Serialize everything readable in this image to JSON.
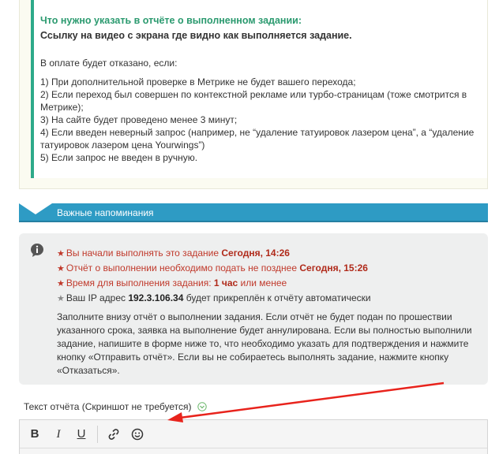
{
  "report_requirements": {
    "title": "Что нужно указать в отчёте о выполненном задании:",
    "subtitle": "Ссылку на видео с экрана где видно как выполняется задание.",
    "refusal_intro": "В оплате будет отказано, если:",
    "refusal_items": [
      "1) При дополнительной проверке в Метрике не будет вашего перехода;",
      "2) Если переход был совершен по контекстной рекламе или турбо-страницам (тоже смотрится в Метрике);",
      "3) На сайте будет проведено менее 3 минут;",
      "4) Если введен неверный запрос (например, не “удаление татуировок лазером цена”, а “удаление татуировок лазером цена Yourwings”)",
      "5) Если запрос не введен в ручную."
    ]
  },
  "section": {
    "title": "Важные напоминания"
  },
  "reminders": {
    "started_prefix": "Вы начали выполнять это задание ",
    "started_value": "Сегодня, 14:26",
    "deadline_prefix": "Отчёт о выполнении необходимо подать не позднее ",
    "deadline_value": "Сегодня, 15:26",
    "time_prefix": "Время для выполнения задания: ",
    "time_value": "1 час",
    "time_suffix": " или менее",
    "ip_prefix": "Ваш IP адрес ",
    "ip_value": "192.3.106.34",
    "ip_suffix": " будет прикреплён к отчёту автоматически",
    "paragraph": "Заполните внизу отчёт о выполнении задания. Если отчёт не будет подан по прошествии указанного срока, заявка на выполнение будет аннулирована. Если вы полностью выполнили задание, напишите в форме ниже то, что необходимо указать для подтверждения и нажмите кнопку «Отправить отчёт». Если вы не собираетесь выполнять задание, нажмите кнопку «Отказаться»."
  },
  "report_field": {
    "label": "Текст отчёта (Скриншот не требуется)"
  },
  "toolbar": {
    "bold": "B",
    "italic": "I",
    "underline": "U"
  },
  "colors": {
    "accent_green": "#2b9a6f",
    "section_blue": "#2e9bc4",
    "warning_red": "#c0392b",
    "arrow_red": "#e8231c"
  }
}
